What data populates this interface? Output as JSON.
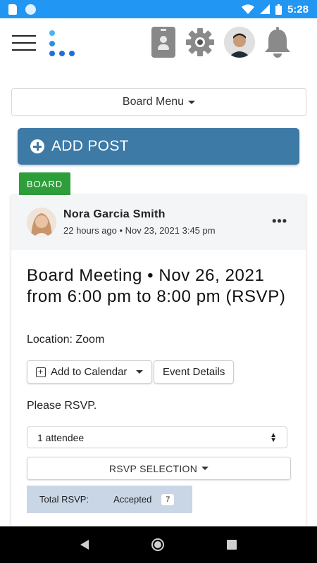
{
  "status_bar": {
    "time": "5:28"
  },
  "header": {
    "menu_icon": "hamburger-icon",
    "logo_icon": "dots-logo-icon",
    "icons": [
      "id-card-icon",
      "gear-icon",
      "avatar",
      "bell-icon"
    ]
  },
  "board_menu": {
    "label": "Board Menu"
  },
  "add_post": {
    "label": "ADD POST"
  },
  "tag": {
    "label": "BOARD"
  },
  "post": {
    "author": "Nora Garcia Smith",
    "meta": "22 hours ago • Nov 23, 2021 3:45 pm",
    "more": "•••",
    "title": "Board Meeting • Nov 26, 2021 from 6:00 pm to 8:00 pm (RSVP)",
    "location": "Location: Zoom",
    "add_to_calendar": "Add to Calendar",
    "event_details": "Event Details",
    "please_rsvp": "Please RSVP.",
    "attendee_select": "1 attendee",
    "rsvp_selection": "RSVP SELECTION",
    "total_rsvp": "Total RSVP:",
    "accepted": "Accepted",
    "accepted_count": "7"
  },
  "colors": {
    "status_bar": "#2196f3",
    "add_post_bg": "#3d7aa6",
    "tag_bg": "#2e9e3a",
    "total_bg": "#c9d6e6"
  }
}
